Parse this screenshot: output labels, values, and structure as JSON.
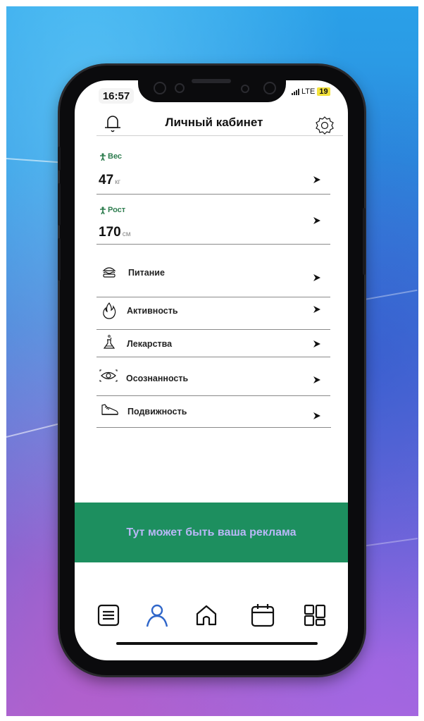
{
  "status_bar": {
    "time": "16:57",
    "network": "LTE",
    "battery": "19"
  },
  "header": {
    "title": "Личный кабинет",
    "bell_icon": "bell-icon",
    "settings_icon": "gear-icon"
  },
  "metrics": [
    {
      "label": "Вес",
      "value": "47",
      "unit": "кг"
    },
    {
      "label": "Рост",
      "value": "170",
      "unit": "см"
    }
  ],
  "menu": [
    {
      "label": "Питание",
      "icon": "burger-icon"
    },
    {
      "label": "Активность",
      "icon": "flame-icon"
    },
    {
      "label": "Лекарства",
      "icon": "flask-icon"
    },
    {
      "label": "Осознанность",
      "icon": "eye-icon"
    },
    {
      "label": "Подвижность",
      "icon": "sneaker-icon"
    }
  ],
  "ad": {
    "text": "Тут может быть ваша реклама",
    "background": "#1d8f5f",
    "text_color": "#b9b8f7"
  },
  "tab_bar": {
    "items": [
      "list-icon",
      "profile-icon",
      "home-icon",
      "calendar-icon",
      "dashboard-icon"
    ],
    "active": "profile-icon",
    "active_color": "#2f66c9"
  },
  "colors": {
    "metric_label": "#2e7d4f",
    "phone_frame": "#0b0b0d"
  }
}
